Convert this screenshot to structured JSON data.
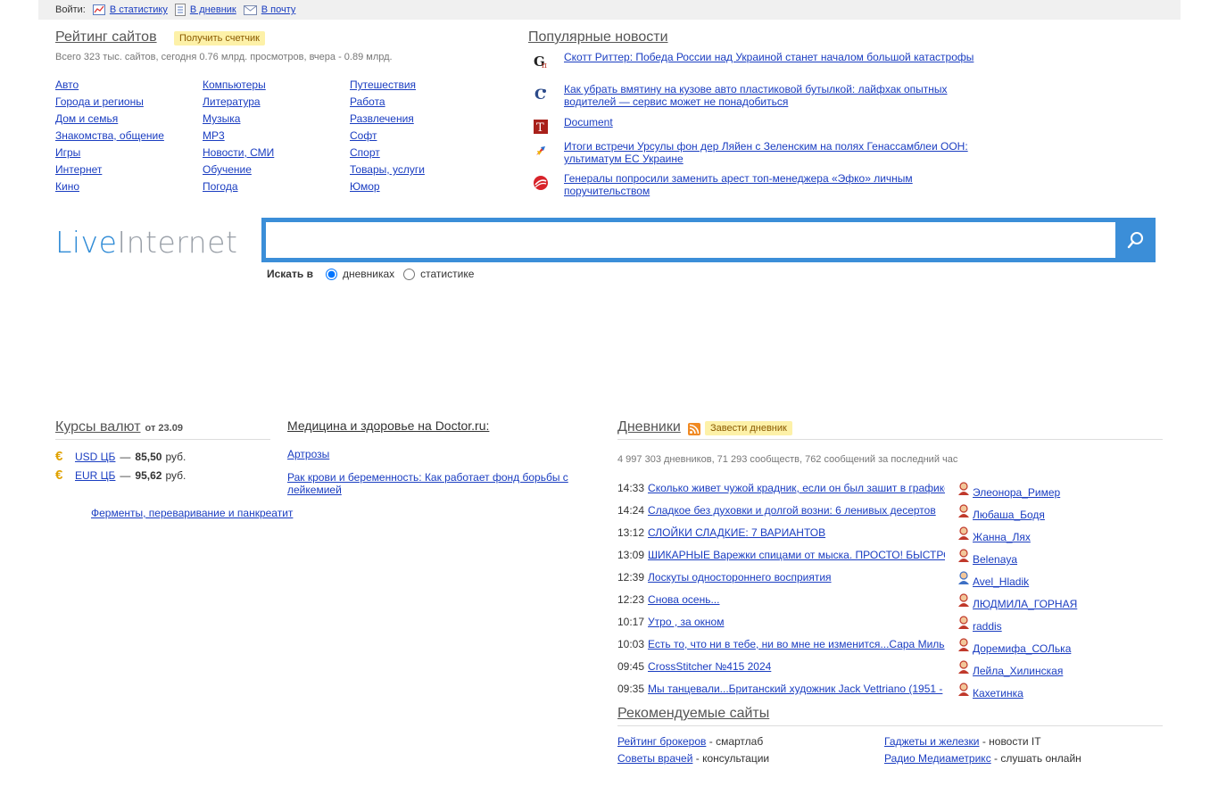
{
  "topbar": {
    "login_label": "Войти:",
    "links": [
      {
        "label": "В статистику",
        "icon": "statistics-icon"
      },
      {
        "label": "В дневник",
        "icon": "diary-icon"
      },
      {
        "label": "В почту",
        "icon": "mail-icon"
      }
    ]
  },
  "rating": {
    "title": "Рейтинг сайтов",
    "badge": "Получить счетчик",
    "summary": "Всего 323 тыс. сайтов, сегодня 0.76 млрд. просмотров, вчера - 0.89 млрд.",
    "columns": [
      [
        "Авто",
        "Города и регионы",
        "Дом и семья",
        "Знакомства, общение",
        "Игры",
        "Интернет",
        "Кино"
      ],
      [
        "Компьютеры",
        "Литература",
        "Музыка",
        "MP3",
        "Новости, СМИ",
        "Обучение",
        "Погода"
      ],
      [
        "Путешествия",
        "Работа",
        "Развлечения",
        "Софт",
        "Спорт",
        "Товары, услуги",
        "Юмор"
      ]
    ]
  },
  "news": {
    "title": "Популярные новости",
    "items": [
      {
        "text": "Скотт Риттер: Победа России над Украиной станет началом большой катастрофы",
        "icon": "news-source-g-icon"
      },
      {
        "text": "Как убрать вмятину на кузове авто пластиковой бутылкой: лайфхак опытных водителей — сервис может не понадобиться",
        "icon": "news-source-c-icon"
      },
      {
        "text": "Document",
        "icon": "news-source-t-icon"
      },
      {
        "text": "Итоги встречи Урсулы фон дер Ляйен с Зеленским на полях Генассамблеи ООН: ультиматум ЕС Украине",
        "icon": "news-source-star-icon"
      },
      {
        "text": "Генералы попросили заменить арест топ-менеджера «Эфко» личным поручительством",
        "icon": "news-source-red-icon"
      }
    ]
  },
  "logo": {
    "part1": "Live",
    "part2": "Internet"
  },
  "search": {
    "value": "",
    "label": "Искать в",
    "options": [
      {
        "label": "дневниках",
        "checked": true
      },
      {
        "label": "статистике",
        "checked": false
      }
    ]
  },
  "currency": {
    "title": "Курсы валют",
    "date": "от 23.09",
    "rows": [
      {
        "name": "USD ЦБ",
        "dash": "—",
        "value": "85,50",
        "unit": "руб."
      },
      {
        "name": "EUR ЦБ",
        "dash": "—",
        "value": "95,62",
        "unit": "руб."
      }
    ]
  },
  "medicine": {
    "title": "Медицина и здоровье на Doctor.ru:",
    "links": [
      "Артрозы",
      "Рак крови и беременность: Как работает фонд борьбы с лейкемией",
      "Ферменты, переваривание и панкреатит"
    ]
  },
  "diaries": {
    "title": "Дневники",
    "badge": "Завести дневник",
    "summary": "4 997 303 дневников, 71 293 сообществ, 762 сообщений за последний час",
    "posts": [
      {
        "time": "14:33",
        "title": "Сколько живет чужой крадник, если он был зашит в графике"
      },
      {
        "time": "14:24",
        "title": "Сладкое без духовки и долгой возни: 6 ленивых десертов"
      },
      {
        "time": "13:12",
        "title": "СЛОЙКИ СЛАДКИЕ: 7 ВАРИАНТОВ"
      },
      {
        "time": "13:09",
        "title": "ШИКАРНЫЕ Варежки спицами от мыска. ПРОСТО! БЫСТРО!"
      },
      {
        "time": "12:39",
        "title": "Лоскуты одностороннего восприятия"
      },
      {
        "time": "12:23",
        "title": "Снова осень..."
      },
      {
        "time": "10:17",
        "title": "Утро , за окном"
      },
      {
        "time": "10:03",
        "title": "Есть то, что ни в тебе, ни во мне не изменится...Сара Миль"
      },
      {
        "time": "09:45",
        "title": "CrossStitcher №415 2024"
      },
      {
        "time": "09:35",
        "title": "Мы танцевали...Британский художник Jack Vettriano (1951 -"
      }
    ],
    "users": [
      {
        "name": "Элеонора_Ример",
        "gender": "female"
      },
      {
        "name": "Любаша_Бодя",
        "gender": "female"
      },
      {
        "name": "Жанна_Лях",
        "gender": "female"
      },
      {
        "name": "Belenaya",
        "gender": "female"
      },
      {
        "name": "Avel_Hladik",
        "gender": "male"
      },
      {
        "name": "ЛЮДМИЛА_ГОРНАЯ",
        "gender": "female"
      },
      {
        "name": "raddis",
        "gender": "female"
      },
      {
        "name": "Доремифа_СОЛька",
        "gender": "female"
      },
      {
        "name": "Лейла_Хилинская",
        "gender": "female"
      },
      {
        "name": "Кахетинка",
        "gender": "female"
      }
    ]
  },
  "recommended": {
    "title": "Рекомендуемые сайты",
    "items": [
      {
        "link": "Рейтинг брокеров",
        "desc": "- смартлаб"
      },
      {
        "link": "Гаджеты и железки",
        "desc": "- новости IT"
      },
      {
        "link": "Советы врачей",
        "desc": "- консультации"
      },
      {
        "link": "Радио Медиаметрикс",
        "desc": "- слушать онлайн"
      }
    ]
  },
  "colors": {
    "link": "#1a3dc1",
    "accent": "#3b8ed8",
    "badge_bg": "#fdf1a8",
    "rss": "#f08a24"
  }
}
